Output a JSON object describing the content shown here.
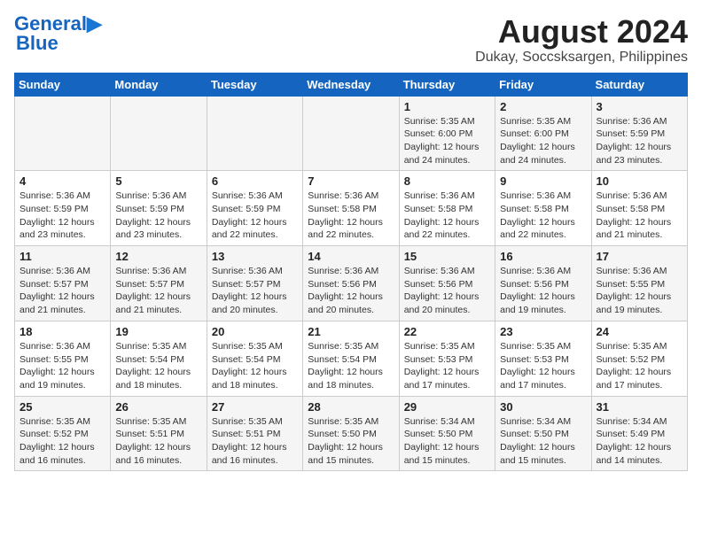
{
  "header": {
    "logo_line1": "General",
    "logo_line2": "Blue",
    "title": "August 2024",
    "subtitle": "Dukay, Soccsksargen, Philippines"
  },
  "weekdays": [
    "Sunday",
    "Monday",
    "Tuesday",
    "Wednesday",
    "Thursday",
    "Friday",
    "Saturday"
  ],
  "weeks": [
    [
      {
        "day": "",
        "info": ""
      },
      {
        "day": "",
        "info": ""
      },
      {
        "day": "",
        "info": ""
      },
      {
        "day": "",
        "info": ""
      },
      {
        "day": "1",
        "info": "Sunrise: 5:35 AM\nSunset: 6:00 PM\nDaylight: 12 hours\nand 24 minutes."
      },
      {
        "day": "2",
        "info": "Sunrise: 5:35 AM\nSunset: 6:00 PM\nDaylight: 12 hours\nand 24 minutes."
      },
      {
        "day": "3",
        "info": "Sunrise: 5:36 AM\nSunset: 5:59 PM\nDaylight: 12 hours\nand 23 minutes."
      }
    ],
    [
      {
        "day": "4",
        "info": "Sunrise: 5:36 AM\nSunset: 5:59 PM\nDaylight: 12 hours\nand 23 minutes."
      },
      {
        "day": "5",
        "info": "Sunrise: 5:36 AM\nSunset: 5:59 PM\nDaylight: 12 hours\nand 23 minutes."
      },
      {
        "day": "6",
        "info": "Sunrise: 5:36 AM\nSunset: 5:59 PM\nDaylight: 12 hours\nand 22 minutes."
      },
      {
        "day": "7",
        "info": "Sunrise: 5:36 AM\nSunset: 5:58 PM\nDaylight: 12 hours\nand 22 minutes."
      },
      {
        "day": "8",
        "info": "Sunrise: 5:36 AM\nSunset: 5:58 PM\nDaylight: 12 hours\nand 22 minutes."
      },
      {
        "day": "9",
        "info": "Sunrise: 5:36 AM\nSunset: 5:58 PM\nDaylight: 12 hours\nand 22 minutes."
      },
      {
        "day": "10",
        "info": "Sunrise: 5:36 AM\nSunset: 5:58 PM\nDaylight: 12 hours\nand 21 minutes."
      }
    ],
    [
      {
        "day": "11",
        "info": "Sunrise: 5:36 AM\nSunset: 5:57 PM\nDaylight: 12 hours\nand 21 minutes."
      },
      {
        "day": "12",
        "info": "Sunrise: 5:36 AM\nSunset: 5:57 PM\nDaylight: 12 hours\nand 21 minutes."
      },
      {
        "day": "13",
        "info": "Sunrise: 5:36 AM\nSunset: 5:57 PM\nDaylight: 12 hours\nand 20 minutes."
      },
      {
        "day": "14",
        "info": "Sunrise: 5:36 AM\nSunset: 5:56 PM\nDaylight: 12 hours\nand 20 minutes."
      },
      {
        "day": "15",
        "info": "Sunrise: 5:36 AM\nSunset: 5:56 PM\nDaylight: 12 hours\nand 20 minutes."
      },
      {
        "day": "16",
        "info": "Sunrise: 5:36 AM\nSunset: 5:56 PM\nDaylight: 12 hours\nand 19 minutes."
      },
      {
        "day": "17",
        "info": "Sunrise: 5:36 AM\nSunset: 5:55 PM\nDaylight: 12 hours\nand 19 minutes."
      }
    ],
    [
      {
        "day": "18",
        "info": "Sunrise: 5:36 AM\nSunset: 5:55 PM\nDaylight: 12 hours\nand 19 minutes."
      },
      {
        "day": "19",
        "info": "Sunrise: 5:35 AM\nSunset: 5:54 PM\nDaylight: 12 hours\nand 18 minutes."
      },
      {
        "day": "20",
        "info": "Sunrise: 5:35 AM\nSunset: 5:54 PM\nDaylight: 12 hours\nand 18 minutes."
      },
      {
        "day": "21",
        "info": "Sunrise: 5:35 AM\nSunset: 5:54 PM\nDaylight: 12 hours\nand 18 minutes."
      },
      {
        "day": "22",
        "info": "Sunrise: 5:35 AM\nSunset: 5:53 PM\nDaylight: 12 hours\nand 17 minutes."
      },
      {
        "day": "23",
        "info": "Sunrise: 5:35 AM\nSunset: 5:53 PM\nDaylight: 12 hours\nand 17 minutes."
      },
      {
        "day": "24",
        "info": "Sunrise: 5:35 AM\nSunset: 5:52 PM\nDaylight: 12 hours\nand 17 minutes."
      }
    ],
    [
      {
        "day": "25",
        "info": "Sunrise: 5:35 AM\nSunset: 5:52 PM\nDaylight: 12 hours\nand 16 minutes."
      },
      {
        "day": "26",
        "info": "Sunrise: 5:35 AM\nSunset: 5:51 PM\nDaylight: 12 hours\nand 16 minutes."
      },
      {
        "day": "27",
        "info": "Sunrise: 5:35 AM\nSunset: 5:51 PM\nDaylight: 12 hours\nand 16 minutes."
      },
      {
        "day": "28",
        "info": "Sunrise: 5:35 AM\nSunset: 5:50 PM\nDaylight: 12 hours\nand 15 minutes."
      },
      {
        "day": "29",
        "info": "Sunrise: 5:34 AM\nSunset: 5:50 PM\nDaylight: 12 hours\nand 15 minutes."
      },
      {
        "day": "30",
        "info": "Sunrise: 5:34 AM\nSunset: 5:50 PM\nDaylight: 12 hours\nand 15 minutes."
      },
      {
        "day": "31",
        "info": "Sunrise: 5:34 AM\nSunset: 5:49 PM\nDaylight: 12 hours\nand 14 minutes."
      }
    ]
  ]
}
